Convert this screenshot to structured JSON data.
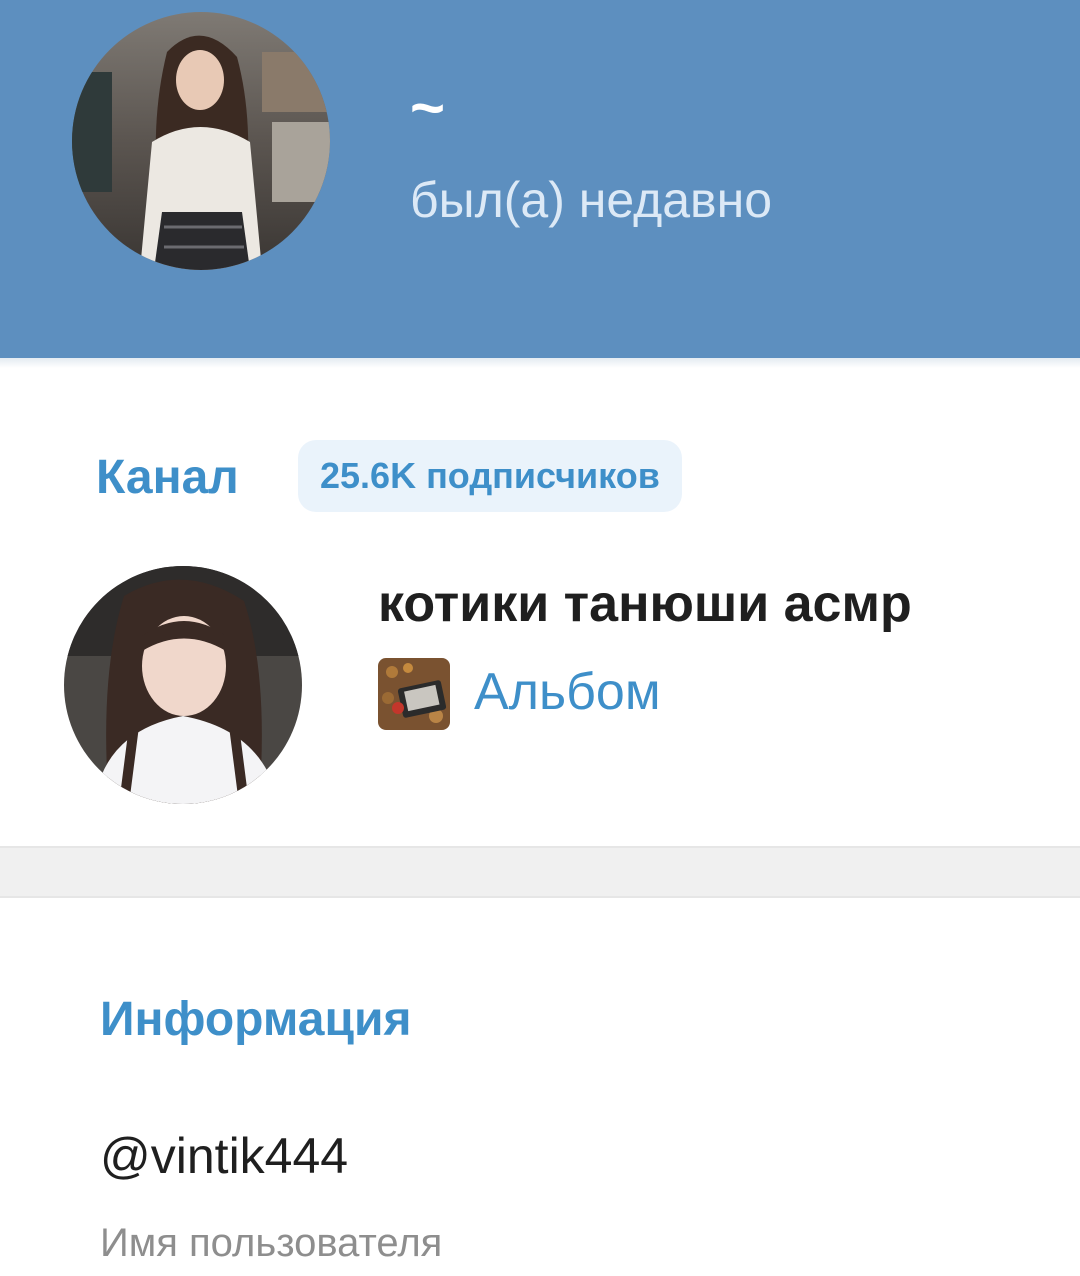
{
  "header": {
    "name": "~",
    "status": "был(а) недавно",
    "avatar_icon": "profile-photo"
  },
  "channel": {
    "heading": "Канал",
    "subscribers_badge": "25.6K подписчиков",
    "title": "котики танюши асмр",
    "last_post_label": "Альбом",
    "avatar_icon": "channel-photo",
    "album_icon": "album-thumbnail"
  },
  "info": {
    "heading": "Информация",
    "username": "@vintik444",
    "username_caption": "Имя пользователя"
  },
  "colors": {
    "header_bg": "#5d8fbf",
    "accent": "#3e8fc9",
    "badge_bg": "#eaf3fb",
    "divider_bg": "#f0f0f0"
  }
}
